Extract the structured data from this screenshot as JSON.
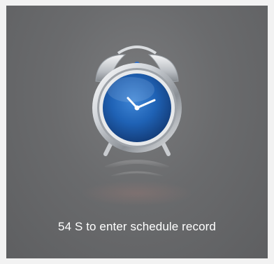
{
  "dialog": {
    "message": "54 S to enter schedule record",
    "icon": "alarm-clock-icon",
    "colors": {
      "background": "#6a6b6d",
      "clock_face": "#1e63b8",
      "text": "#ffffff"
    }
  }
}
